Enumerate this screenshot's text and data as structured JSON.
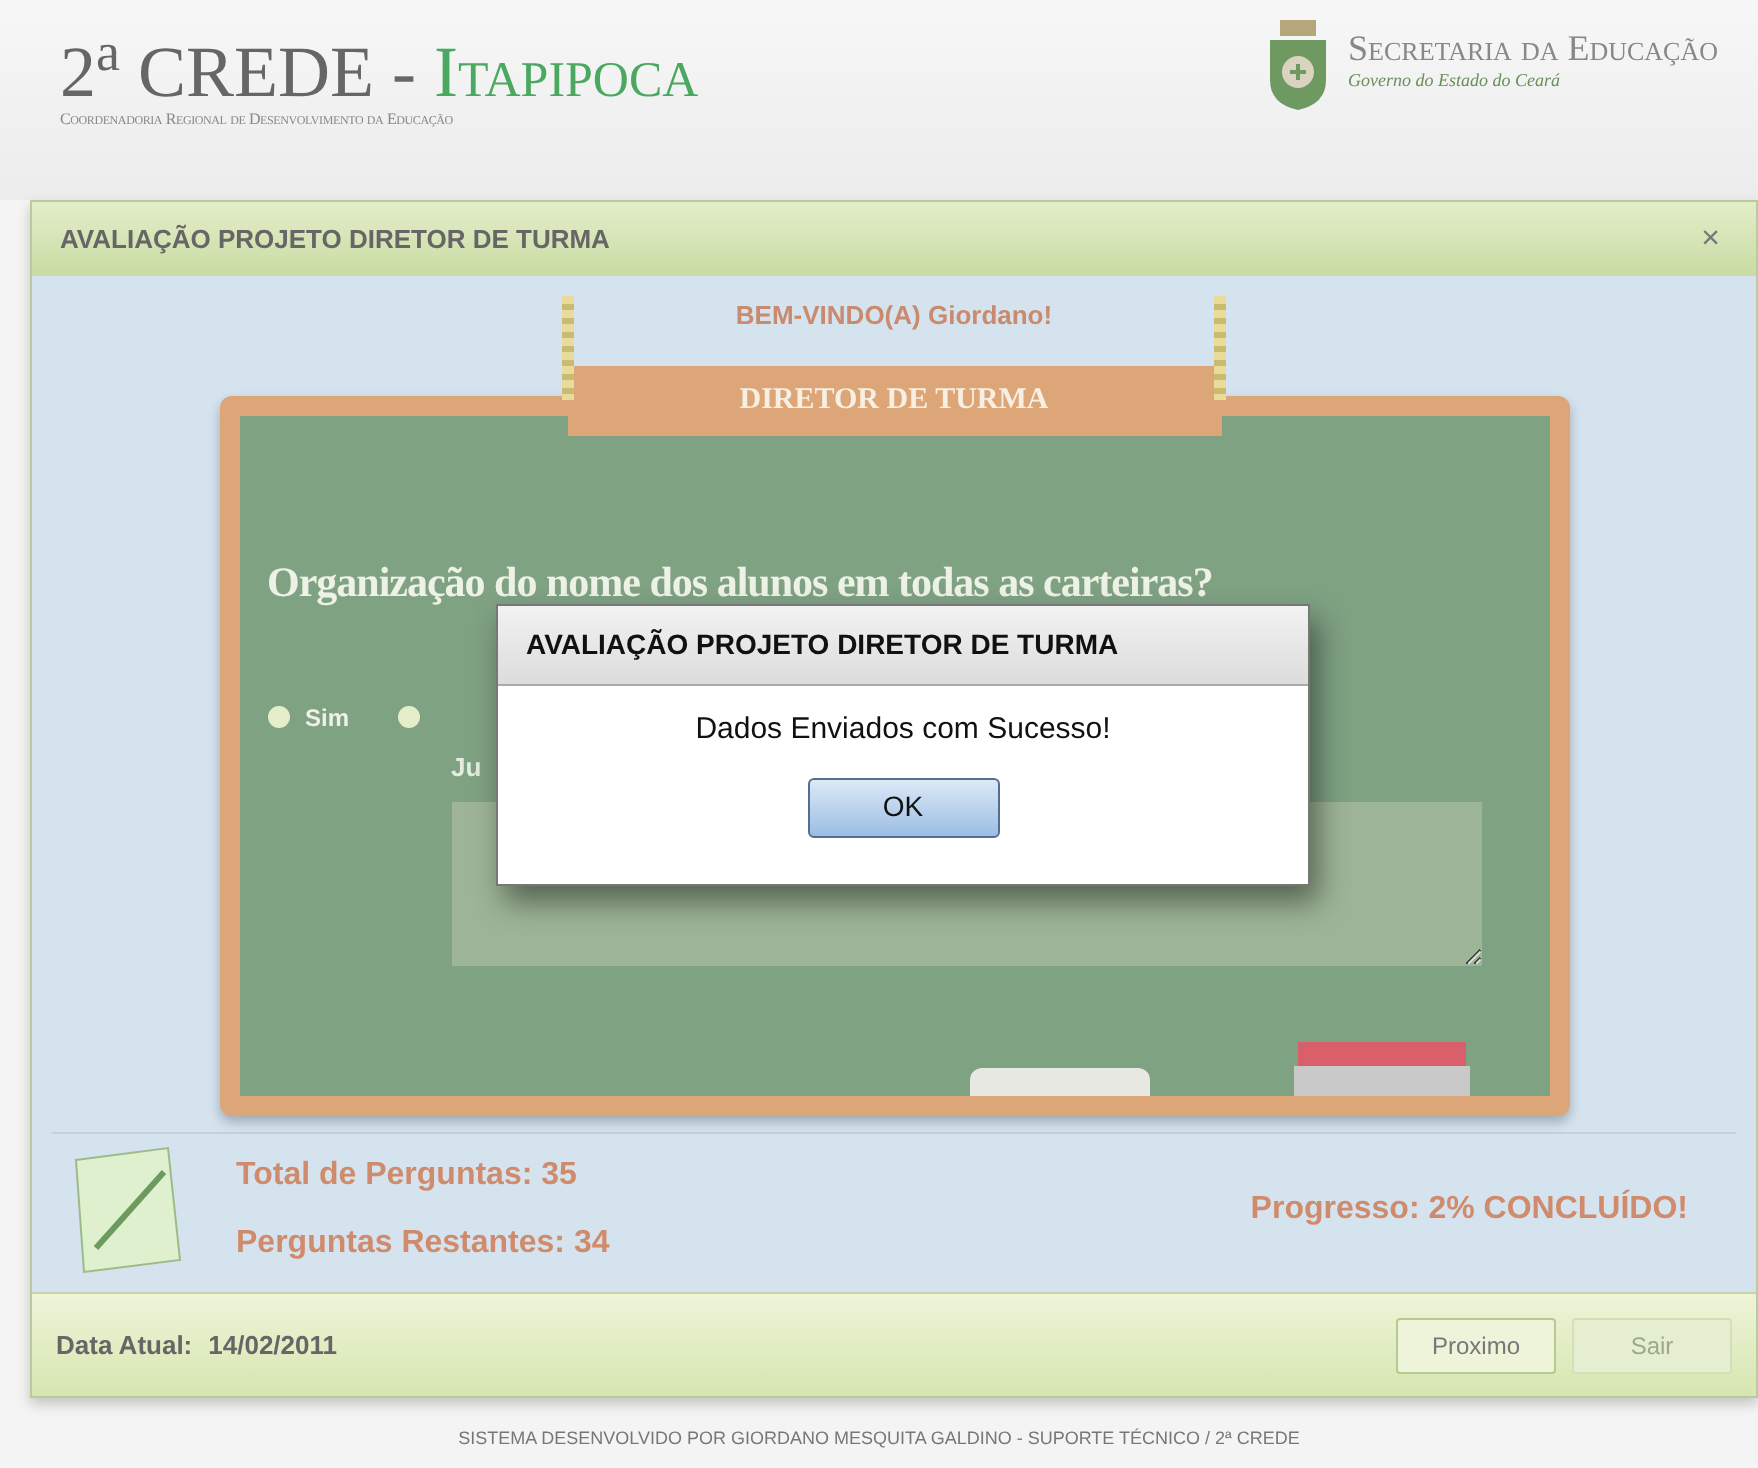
{
  "header": {
    "brand": "2$^{a}$ CREDE -",
    "brand_city": "Itapipoca",
    "brand_subtitle": "Coordenadoria Regional de Desenvolvimento da Educação",
    "secretariat": "Secretaria da Educação",
    "government": "Governo do Estado do Ceará"
  },
  "panel": {
    "title": "AVALIAÇÃO PROJETO DIRETOR DE TURMA",
    "close": "×"
  },
  "welcome": "BEM-VINDO(A) Giordano!",
  "board": {
    "title": "DIRETOR DE TURMA",
    "question": "Organização do nome dos alunos em todas as carteiras?",
    "options": [
      {
        "label": "Sim",
        "selected": false
      },
      {
        "selected": false
      }
    ],
    "justification_label": "Ju"
  },
  "stats": {
    "total": "Total de Perguntas: 35",
    "remaining": "Perguntas Restantes: 34",
    "progress": "Progresso: 2% CONCLUÍDO!"
  },
  "footer": {
    "date_label": "Data Atual:",
    "date": "14/02/2011",
    "buttons": [
      {
        "label": "Proximo",
        "disabled": false
      },
      {
        "label": "Sair",
        "disabled": true
      }
    ]
  },
  "dialog": {
    "title": "AVALIAÇÃO PROJETO DIRETOR DE TURMA",
    "message": "Dados Enviados com Sucesso!",
    "button": "OK"
  },
  "credit": "SISTEMA DESENVOLVIDO POR GIORDANO MESQUITA GALDINO - SUPORTE TÉCNICO / 2ª CREDE"
}
